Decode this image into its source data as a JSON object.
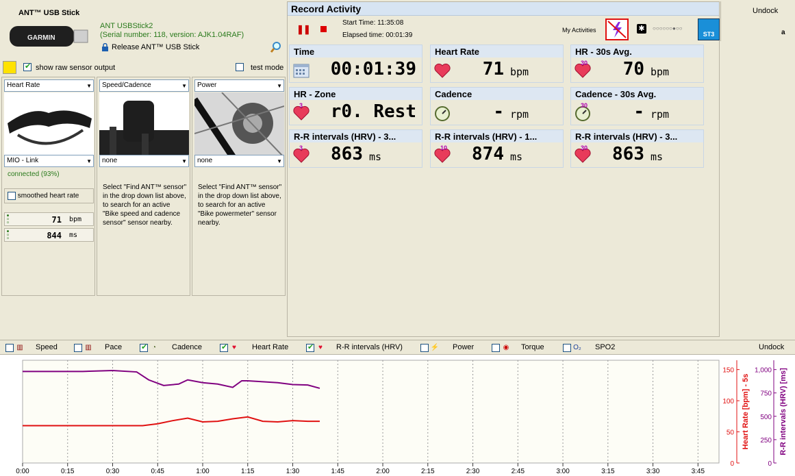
{
  "ant": {
    "title": "ANT™ USB Stick",
    "stick_name": "ANT USBStick2",
    "serial": "(Serial number: 118, version: AJK1.04RAF)",
    "release": "Release ANT™ USB Stick",
    "brand": "GARMIN"
  },
  "options": {
    "show_raw": "show raw sensor output",
    "test_mode": "test mode"
  },
  "sensors": [
    {
      "type": "Heart Rate",
      "device": "MIO - Link",
      "status": "connected (93%)",
      "smooth": "smoothed heart rate",
      "hr_value": "71",
      "hr_unit": "bpm",
      "rr_value": "844",
      "rr_unit": "ms"
    },
    {
      "type": "Speed/Cadence",
      "device": "none",
      "desc": "Select \"Find ANT™ sensor\" in the drop down list above, to search for an active \"Bike speed and cadence sensor\" sensor nearby."
    },
    {
      "type": "Power",
      "device": "none",
      "desc": "Select \"Find ANT™ sensor\" in the drop down list above, to search for an active \"Bike powermeter\" sensor nearby."
    }
  ],
  "record": {
    "title": "Record Activity",
    "start_time": "Start Time: 11:35:08",
    "elapsed": "Elapsed time: 00:01:39",
    "my_activities": "My Activities",
    "st3": "ST3"
  },
  "cards": [
    {
      "title": "Time",
      "value": "00:01:39",
      "unit": "",
      "icon": "calendar-icon",
      "sup": ""
    },
    {
      "title": "Heart Rate",
      "value": "71",
      "unit": "bpm",
      "icon": "heart-icon",
      "sup": ""
    },
    {
      "title": "HR - 30s Avg.",
      "value": "70",
      "unit": "bpm",
      "icon": "heart-icon",
      "sup": "30"
    },
    {
      "title": "HR - Zone",
      "value": "r0. Rest",
      "unit": "",
      "icon": "heart-icon",
      "sup": "3"
    },
    {
      "title": "Cadence",
      "value": "-",
      "unit": "rpm",
      "icon": "stopwatch-icon",
      "sup": ""
    },
    {
      "title": "Cadence - 30s Avg.",
      "value": "-",
      "unit": "rpm",
      "icon": "stopwatch-icon",
      "sup": "30"
    },
    {
      "title": "R-R intervals (HRV) - 3...",
      "value": "863",
      "unit": "ms",
      "icon": "heart-icon",
      "sup": "3"
    },
    {
      "title": "R-R intervals (HRV) - 1...",
      "value": "874",
      "unit": "ms",
      "icon": "heart-icon",
      "sup": "10"
    },
    {
      "title": "R-R intervals (HRV) - 3...",
      "value": "863",
      "unit": "ms",
      "icon": "heart-icon",
      "sup": "30"
    }
  ],
  "undock_top": "Undock",
  "side_letter": "a",
  "legend": {
    "items": [
      {
        "label": "Speed",
        "checked": false
      },
      {
        "label": "Pace",
        "checked": false
      },
      {
        "label": "Cadence",
        "checked": true
      },
      {
        "label": "Heart Rate",
        "checked": true
      },
      {
        "label": "R-R intervals (HRV)",
        "checked": true
      },
      {
        "label": "Power",
        "checked": false
      },
      {
        "label": "Torque",
        "checked": false
      },
      {
        "label": "SPO2",
        "checked": false
      }
    ],
    "undock": "Undock"
  },
  "chart_data": {
    "type": "line",
    "xlabel": "",
    "x_ticks": [
      "0:00",
      "0:15",
      "0:30",
      "0:45",
      "1:00",
      "1:15",
      "1:30",
      "1:45",
      "2:00",
      "2:15",
      "2:30",
      "2:45",
      "3:00",
      "3:15",
      "3:30",
      "3:45"
    ],
    "xlim": [
      0,
      232
    ],
    "axes": [
      {
        "label": "Heart Rate [bpm] - 5s",
        "ticks": [
          "0",
          "50",
          "100",
          "150"
        ],
        "ylim": [
          0,
          165
        ],
        "color": "#e01010"
      },
      {
        "label": "R-R intervals (HRV) [ms]",
        "ticks": [
          "0",
          "250",
          "500",
          "750",
          "1,000"
        ],
        "ylim": [
          0,
          1100
        ],
        "color": "#800080"
      }
    ],
    "series": [
      {
        "name": "Heart Rate",
        "color": "#e01010",
        "x": [
          0,
          10,
          20,
          30,
          40,
          45,
          50,
          55,
          60,
          65,
          70,
          75,
          80,
          85,
          90,
          95,
          99
        ],
        "values": [
          60,
          60,
          60,
          60,
          60,
          63,
          68,
          72,
          66,
          67,
          71,
          74,
          67,
          66,
          68,
          67,
          67
        ]
      },
      {
        "name": "R-R intervals (HRV)",
        "color": "#800080",
        "x": [
          0,
          10,
          20,
          30,
          38,
          42,
          47,
          52,
          55,
          60,
          65,
          70,
          73,
          75,
          80,
          85,
          90,
          95,
          99
        ],
        "values": [
          980,
          980,
          980,
          990,
          975,
          890,
          830,
          845,
          890,
          860,
          845,
          810,
          880,
          880,
          870,
          860,
          840,
          835,
          800
        ]
      }
    ]
  }
}
